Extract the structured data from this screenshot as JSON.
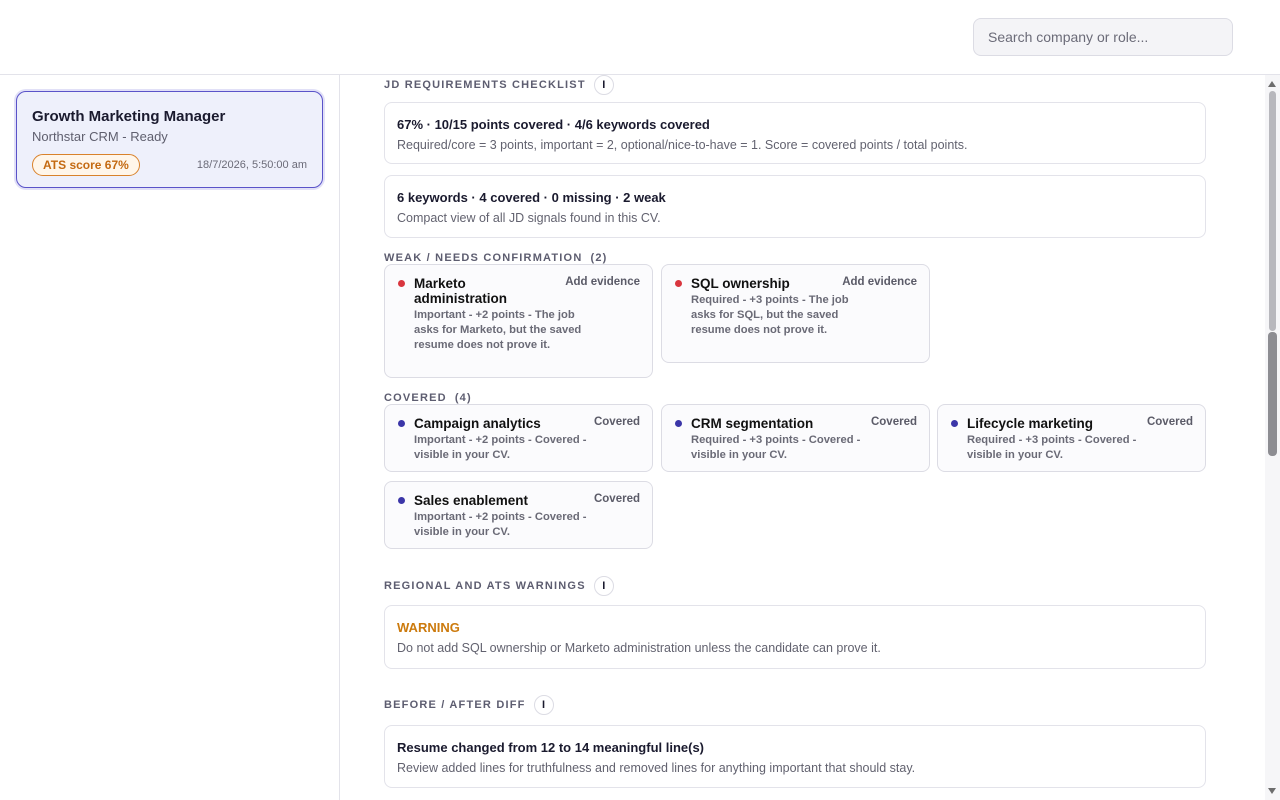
{
  "header": {
    "search_placeholder": "Search company or role..."
  },
  "sidebar": {
    "jobs": [
      {
        "title": "Growth Marketing Manager",
        "subtitle": "Northstar CRM - Ready",
        "ats_badge": "ATS score 67%",
        "date": "18/7/2026, 5:50:00 am"
      }
    ]
  },
  "checklist": {
    "title": "JD REQUIREMENTS CHECKLIST",
    "info_icon": "i",
    "summary_head": "67% · 10/15 points covered · 4/6 keywords covered",
    "summary_desc": "Required/core = 3 points, important = 2, optional/nice-to-have = 1. Score = covered points / total points.",
    "keywords_head": "6 keywords · 4 covered · 0 missing · 2 weak",
    "keywords_desc": "Compact view of all JD signals found in this CV."
  },
  "weak": {
    "title": "WEAK / NEEDS CONFIRMATION",
    "count": "(2)",
    "items": [
      {
        "name": "Marketo administration",
        "action": "Add evidence",
        "desc": "Important - +2 points - The job asks for Marketo, but the saved resume does not prove it."
      },
      {
        "name": "SQL ownership",
        "action": "Add evidence",
        "desc": "Required - +3 points - The job asks for SQL, but the saved resume does not prove it."
      }
    ]
  },
  "covered": {
    "title": "COVERED",
    "count": "(4)",
    "items": [
      {
        "name": "Campaign analytics",
        "action": "Covered",
        "desc": "Important - +2 points - Covered - visible in your CV."
      },
      {
        "name": "CRM segmentation",
        "action": "Covered",
        "desc": "Required - +3 points - Covered - visible in your CV."
      },
      {
        "name": "Lifecycle marketing",
        "action": "Covered",
        "desc": "Required - +3 points - Covered - visible in your CV."
      },
      {
        "name": "Sales enablement",
        "action": "Covered",
        "desc": "Important - +2 points - Covered - visible in your CV."
      }
    ]
  },
  "warnings": {
    "title": "REGIONAL AND ATS WARNINGS",
    "info_icon": "i",
    "label": "WARNING",
    "text": "Do not add SQL ownership or Marketo administration unless the candidate can prove it."
  },
  "diff": {
    "title": "BEFORE / AFTER DIFF",
    "info_icon": "i",
    "head": "Resume changed from 12 to 14 meaningful line(s)",
    "desc": "Review added lines for truthfulness and removed lines for anything important that should stay."
  },
  "colors": {
    "accent": "#5a53c9",
    "ats_orange": "#d9822b",
    "weak_dot": "#d9363e",
    "covered_dot": "#3b36a8",
    "warning": "#cc7a0d"
  }
}
